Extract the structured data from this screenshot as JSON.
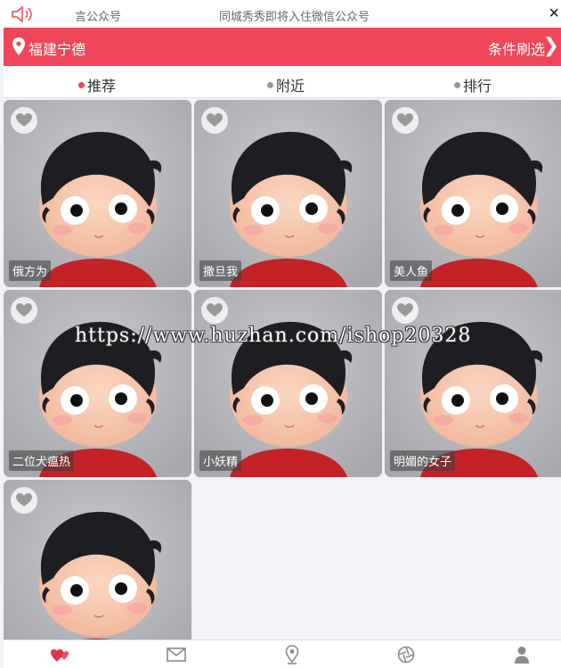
{
  "notice": {
    "icon": "speaker-icon",
    "text_left": "言公众号",
    "text_main": "同城秀秀即将入住微信公众号",
    "close_label": "×"
  },
  "header": {
    "city": "福建宁德",
    "filter_label": "条件刷选",
    "chevron": "❯",
    "accent_color": "#f04659"
  },
  "tabs": [
    {
      "label": "推荐",
      "active": true
    },
    {
      "label": "附近",
      "active": false
    },
    {
      "label": "排行",
      "active": false
    }
  ],
  "cards": [
    {
      "name": "俄方为"
    },
    {
      "name": "撒旦我"
    },
    {
      "name": "美人鱼"
    },
    {
      "name": "二位犬瘟热"
    },
    {
      "name": "小妖精"
    },
    {
      "name": "明媚的女子"
    },
    {
      "name": ""
    }
  ],
  "watermark": "https://www.huzhan.com/ishop20328",
  "bottom_nav": [
    {
      "icon": "hearts-icon",
      "active": true
    },
    {
      "icon": "mail-icon",
      "active": false
    },
    {
      "icon": "location-icon",
      "active": false
    },
    {
      "icon": "camera-aperture-icon",
      "active": false
    },
    {
      "icon": "user-icon",
      "active": false
    }
  ]
}
